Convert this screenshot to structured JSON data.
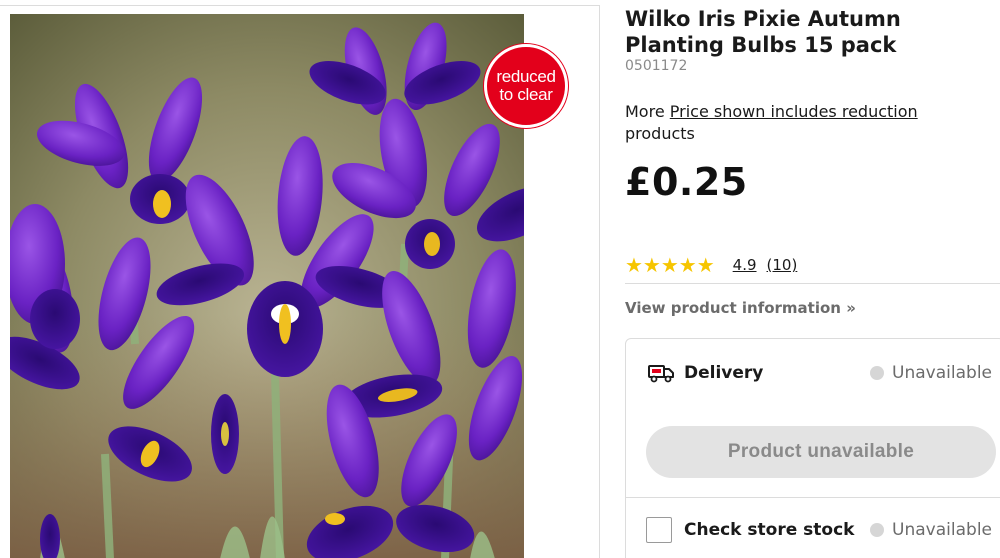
{
  "image": {
    "alt": "Purple iris flowers",
    "badge_line1": "reduced",
    "badge_line2": "to clear",
    "badge_color": "#e3001b"
  },
  "product": {
    "title": "Wilko Iris Pixie Autumn Planting Bulbs 15 pack",
    "sku": "0501172",
    "more_prefix": "More",
    "more_link": "Price shown includes reduction",
    "more_suffix": "products",
    "price": "£0.25"
  },
  "rating": {
    "stars": "★★★★★",
    "value": "4.9",
    "count": "(10)",
    "star_color": "#f6c500"
  },
  "view_info": "View product information »",
  "fulfilment": {
    "delivery_icon": "delivery-van-icon",
    "delivery_label": "Delivery",
    "delivery_status": "Unavailable",
    "button_label": "Product unavailable",
    "store_label": "Check store stock",
    "store_status": "Unavailable"
  }
}
